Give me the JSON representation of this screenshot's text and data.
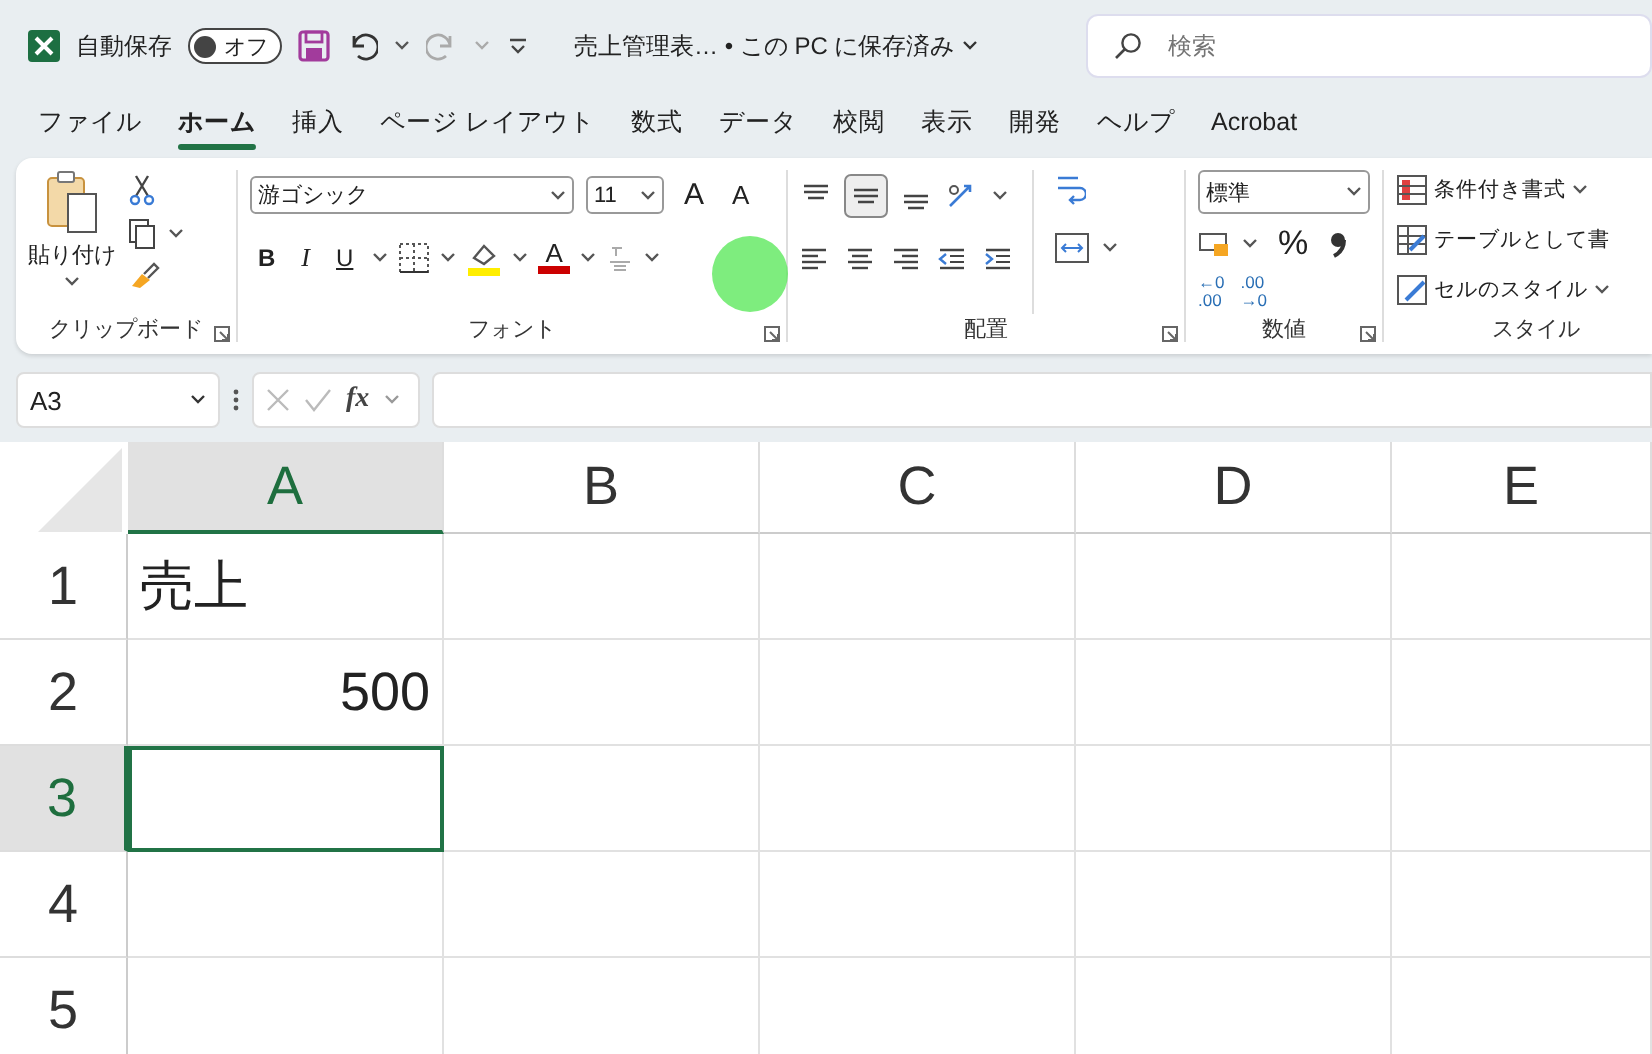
{
  "title_bar": {
    "autosave_label": "自動保存",
    "autosave": {
      "on": false,
      "label": "オフ"
    },
    "document_title": "売上管理表… • この PC に保存済み",
    "search": {
      "placeholder": "検索"
    }
  },
  "tabs": [
    {
      "label": "ファイル",
      "selected": false
    },
    {
      "label": "ホーム",
      "selected": true
    },
    {
      "label": "挿入",
      "selected": false
    },
    {
      "label": "ページ レイアウト",
      "selected": false
    },
    {
      "label": "数式",
      "selected": false
    },
    {
      "label": "データ",
      "selected": false
    },
    {
      "label": "校閲",
      "selected": false
    },
    {
      "label": "表示",
      "selected": false
    },
    {
      "label": "開発",
      "selected": false
    },
    {
      "label": "ヘルプ",
      "selected": false
    },
    {
      "label": "Acrobat",
      "selected": false
    }
  ],
  "ribbon": {
    "clipboard": {
      "paste_label": "貼り付け",
      "group_label": "クリップボード"
    },
    "font": {
      "font_name": "游ゴシック",
      "font_size": "11",
      "grow_font": "A",
      "shrink_font": "A",
      "bold": "B",
      "italic": "I",
      "underline": "U",
      "font_color": "A",
      "group_label": "フォント"
    },
    "alignment": {
      "group_label": "配置"
    },
    "number": {
      "format": "標準",
      "percent": "%",
      "increase_decimal": [
        "←0",
        ".00"
      ],
      "decrease_decimal": [
        ".00",
        "→0"
      ],
      "group_label": "数値"
    },
    "styles": {
      "items": [
        "条件付き書式",
        "テーブルとして書",
        "セルのスタイル"
      ],
      "group_label": "スタイル"
    }
  },
  "formula_bar": {
    "name_box": "A3",
    "function_label": "fx"
  },
  "sheet": {
    "columns": [
      {
        "label": "A",
        "selected": true
      },
      {
        "label": "B",
        "selected": false
      },
      {
        "label": "C",
        "selected": false
      },
      {
        "label": "D",
        "selected": false
      },
      {
        "label": "E",
        "selected": false
      }
    ],
    "rows": [
      {
        "label": "1",
        "selected": false,
        "cells": [
          {
            "value": "売上",
            "kind": "text",
            "selected": false
          }
        ]
      },
      {
        "label": "2",
        "selected": false,
        "cells": [
          {
            "value": "500",
            "kind": "number",
            "selected": false
          }
        ]
      },
      {
        "label": "3",
        "selected": true,
        "cells": [
          {
            "kind": "text",
            "selected": true
          }
        ]
      },
      {
        "label": "4",
        "selected": false,
        "cells": []
      },
      {
        "label": "5",
        "selected": false,
        "cells": []
      }
    ]
  }
}
